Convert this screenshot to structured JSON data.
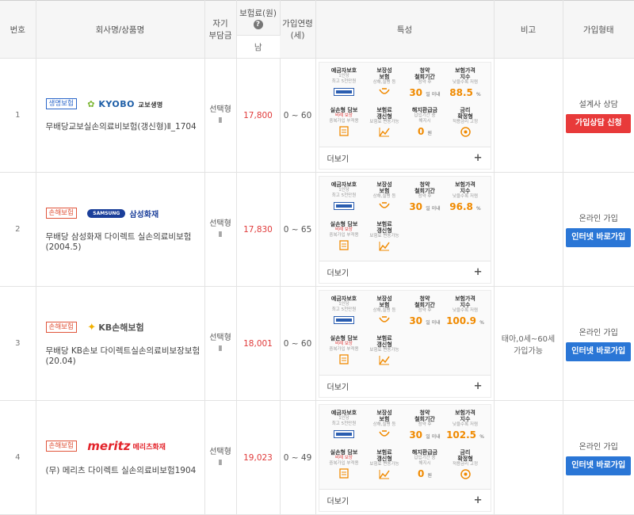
{
  "header": {
    "no": "번호",
    "company_product": "회사명/상품명",
    "self_pay_1": "자기",
    "self_pay_2": "부담금",
    "premium_1": "보험료(원)",
    "premium_help": "?",
    "age_1": "가입연령",
    "age_2": "(세)",
    "features": "특성",
    "note": "비고",
    "join_type": "가입형태",
    "gender": "남"
  },
  "feature_labels": {
    "deposit_title": "예금자보호",
    "deposit_sub1": "1인당",
    "deposit_sub2": "최고 5천만원",
    "coverage_title": "보장성",
    "coverage_title2": "보험",
    "coverage_sub": "상해,질병 등",
    "period_title": "청약",
    "period_title2": "철회기간",
    "period_sub": "청약 후",
    "period_value": "30",
    "period_unit": "일 이내",
    "index_title": "보험가격",
    "index_title2": "지수",
    "index_sub": "낮을수록 저렴",
    "nonpay_title": "실손형 담보",
    "nonpay_red": "비례 보상",
    "nonpay_sub": "중복가입 부적용",
    "renew_title": "보험료",
    "renew_title2": "갱신형",
    "renew_sub": "보험료 변동가능",
    "refund_title": "해지환급금",
    "refund_sub1": "납입기간 중",
    "refund_sub2": "해지시",
    "refund_value": "0",
    "refund_unit": "원",
    "rate_title": "금리",
    "rate_title2": "확정형",
    "rate_sub": "적용금리 고정",
    "more": "더보기",
    "plus": "+"
  },
  "rows": [
    {
      "no": "1",
      "tag": "생명보험",
      "company": "KYOBO 교보생명",
      "product": "무배당교보실손의료비보험(갱신형)Ⅱ_1704",
      "type_1": "선택형",
      "type_2": "Ⅱ",
      "price": "17,800",
      "age": "0 ~ 60",
      "index": "88.5",
      "index_unit": "%",
      "note": "",
      "join_label": "설계사 상담",
      "button": "가입상담 신청"
    },
    {
      "no": "2",
      "tag": "손해보험",
      "company": "SAMSUNG 삼성화재",
      "product": "무배당 삼성화재 다이렉트 실손의료비보험(2004.5)",
      "type_1": "선택형",
      "type_2": "Ⅱ",
      "price": "17,830",
      "age": "0 ~ 65",
      "index": "96.8",
      "index_unit": "%",
      "note": "",
      "join_label": "온라인 가입",
      "button": "인터넷 바로가입"
    },
    {
      "no": "3",
      "tag": "손해보험",
      "company": "KB손해보험",
      "product": "무배당 KB손보 다이렉트실손의료비보장보험(20.04)",
      "type_1": "선택형",
      "type_2": "Ⅱ",
      "price": "18,001",
      "age": "0 ~ 60",
      "index": "100.9",
      "index_unit": "%",
      "note": "태아,0세~60세 가입가능",
      "join_label": "온라인 가입",
      "button": "인터넷 바로가입"
    },
    {
      "no": "4",
      "tag": "손해보험",
      "company": "meritz 메리츠화재",
      "product": "(무) 메리츠 다이렉트 실손의료비보험1904",
      "type_1": "선택형",
      "type_2": "Ⅱ",
      "price": "19,023",
      "age": "0 ~ 49",
      "index": "102.5",
      "index_unit": "%",
      "note": "",
      "join_label": "온라인 가입",
      "button": "인터넷 바로가입"
    }
  ],
  "colors": {
    "price": "#e03a3a",
    "accent_orange": "#f08a00",
    "red_button": "#e83a3a",
    "blue_button": "#2a76d6"
  }
}
